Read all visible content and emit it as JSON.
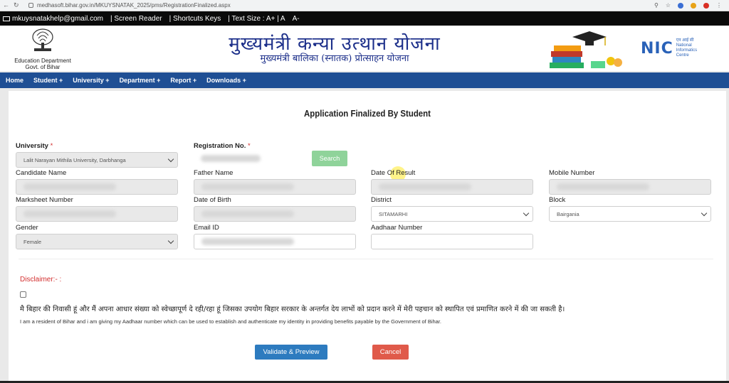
{
  "browser": {
    "url": "medhasoft.bihar.gov.in/MKUYSNATAK_2025/pms/RegistrationFinalized.aspx"
  },
  "topstrip": {
    "email": "mkuysnatakhelp@gmail.com",
    "screen_reader": "| Screen Reader",
    "shortcuts": "| Shortcuts Keys",
    "text_size": "| Text Size : A+ | A",
    "text_minus": "A-"
  },
  "header": {
    "dept_line1": "Education Department",
    "dept_line2": "Govt. of Bihar",
    "title": "मुख्यमंत्री कन्या उत्थान योजना",
    "subtitle": "मुख्यमंत्री बालिका (स्नातक) प्रोत्साहन योजना",
    "nic": "NIC",
    "nic_hi": "एन आई सी",
    "nic_l1": "National",
    "nic_l2": "Informatics",
    "nic_l3": "Centre"
  },
  "nav": {
    "home": "Home",
    "student": "Student +",
    "university": "University +",
    "department": "Department +",
    "report": "Report +",
    "downloads": "Downloads +"
  },
  "form": {
    "heading": "Application Finalized By Student",
    "university_label": "University",
    "university_value": "Lalit Narayan Mithila University, Darbhanga",
    "registration_label": "Registration No.",
    "search": "Search",
    "candidate_label": "Candidate Name",
    "father_label": "Father Name",
    "result_label": "Date Of Result",
    "mobile_label": "Mobile Number",
    "marksheet_label": "Marksheet Number",
    "dob_label": "Date of Birth",
    "district_label": "District",
    "district_value": "SITAMARHI",
    "block_label": "Block",
    "block_value": "Bairgania",
    "gender_label": "Gender",
    "gender_value": "Female",
    "email_label": "Email ID",
    "aadhaar_label": "Aadhaar Number",
    "required_mark": "*"
  },
  "disclaimer": {
    "label": "Disclaimer:- :",
    "hindi": "मै बिहार की निवासी हूं और मैं अपना आधार संख्या को स्वेच्छापूर्ण दे रही/रहा हूं जिसका उपयोग बिहार सरकार के अन्तर्गत देय लाभों को प्रदान करने में मेरी पहचान को स्थापित एवं प्रमाणित करने में की जा सकती है।",
    "english": "I am a resident of Bihar and i am giving my Aadhaar number which can be used to establish and authenticate my identity in providing benefits payable by the Government of Bihar."
  },
  "buttons": {
    "validate": "Validate & Preview",
    "cancel": "Cancel"
  },
  "colors": {
    "nav_bg": "#1f4f94",
    "title": "#1c2f8a",
    "search_btn": "#8fd39a",
    "validate_btn": "#2d7bbf",
    "cancel_btn": "#e05a4a",
    "required": "#d32f2f"
  }
}
